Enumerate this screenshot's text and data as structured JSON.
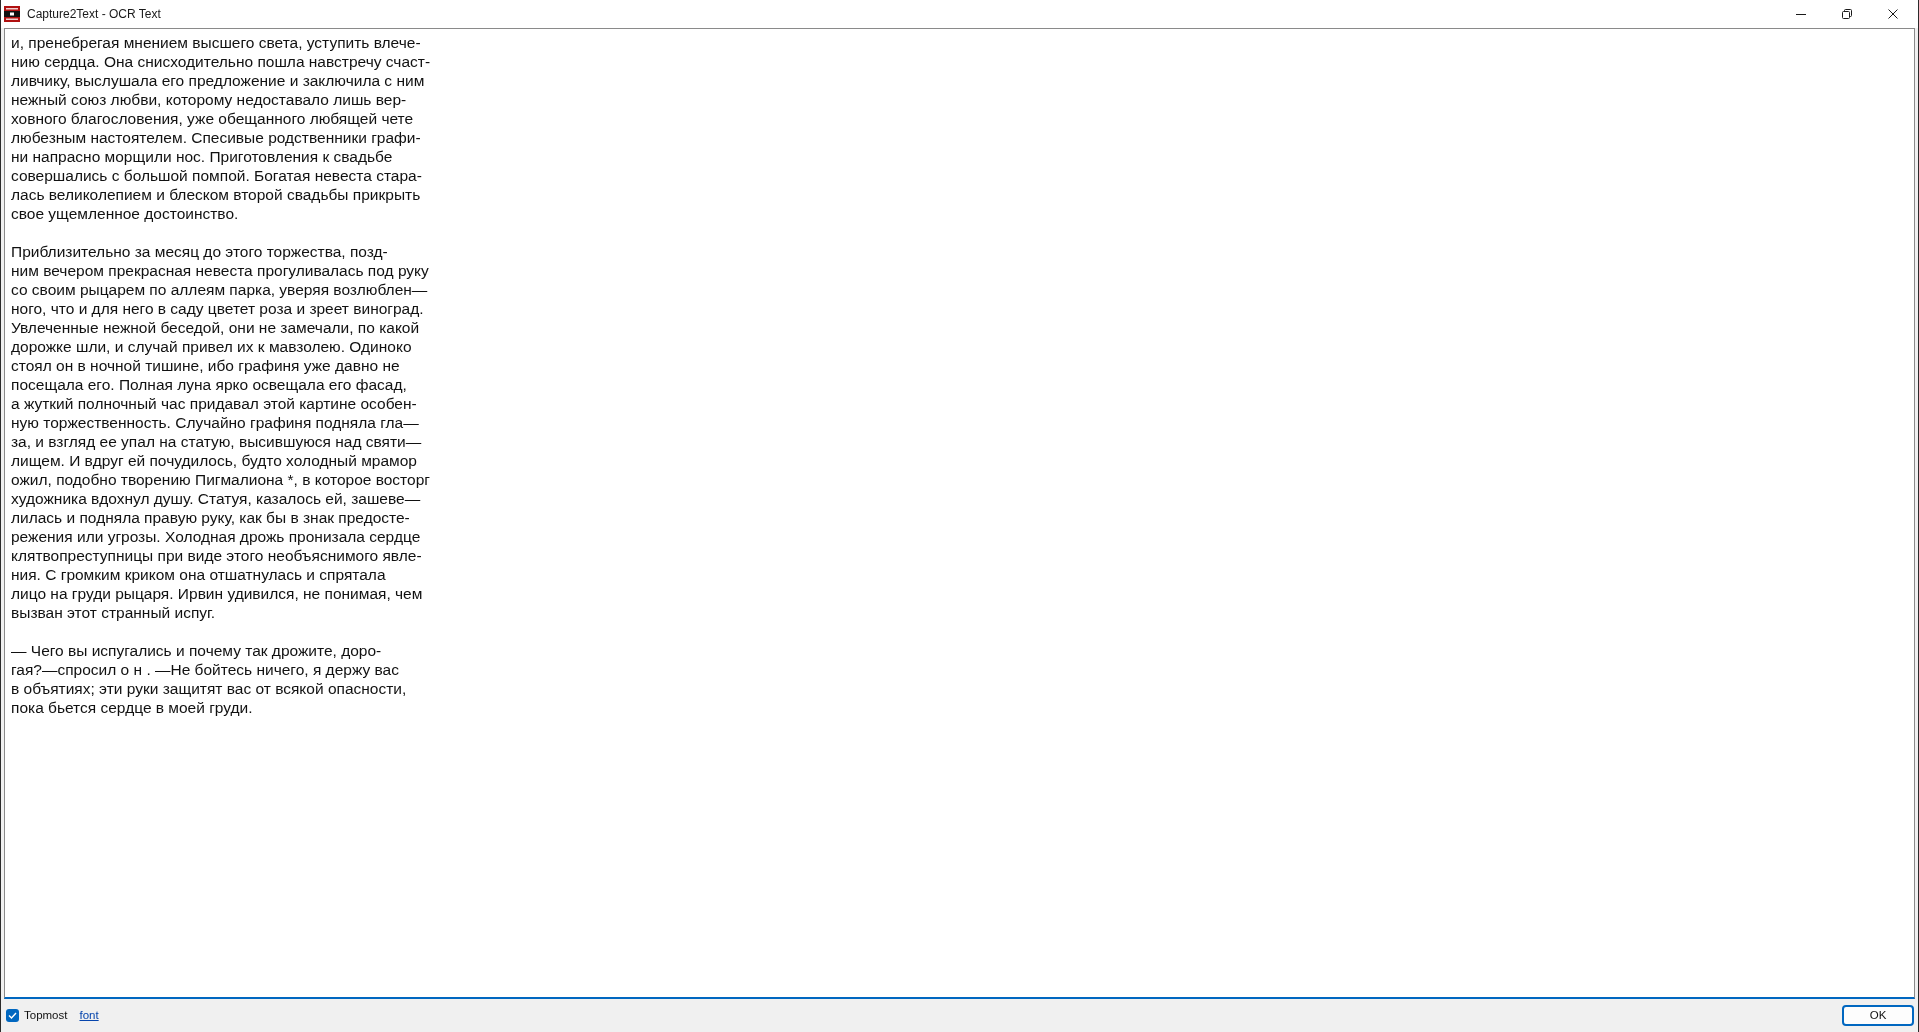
{
  "window": {
    "title": "Capture2Text - OCR Text"
  },
  "ocr_text": {
    "paragraphs": [
      [
        "и, пренебрегая мнением высшего света, уступить влече-",
        "нию сердца. Она снисходительно пошла навстречу счаст-",
        "ливчику, выслушала его предложение и заключила с ним",
        "нежный союз любви, которому недоставало лишь вер-",
        "ховного благословения, уже обещанного любящей чете",
        "любезным настоятелем. Спесивые родственники графи-",
        "ни напрасно морщили нос. Приготовления к свадьбе",
        "совершались с большой помпой. Богатая невеста стара-",
        "лась великолепием и блеском второй свадьбы прикрыть",
        "свое ущемленное достоинство."
      ],
      [
        "Приблизительно за месяц до этого торжества, позд-",
        "ним вечером прекрасная невеста прогуливалась под руку",
        "со своим рыцарем по аллеям парка, уверяя возлюблен—",
        "ного, что и для него в саду цветет роза и зреет виноград.",
        "Увлеченные нежной беседой, они не замечали, по какой",
        "дорожке шли, и случай привел их к мавзолею. Одиноко",
        "стоял он в ночной тишине, ибо графиня уже давно не",
        "посещала его. Полная луна ярко освещала его фасад,",
        "а жуткий полночный час придавал этой картине особен-",
        "ную торжественность. Случайно графиня подняла гла—",
        "за, и взгляд ее упал на статую, высившуюся над святи—",
        "лищем. И вдруг ей почудилось, будто холодный мрамор",
        "ожил, подобно творению Пигмалиона *, в которое восторг",
        "художника вдохнул душу. Статуя, казалось ей, зашеве—",
        "лилась и подняла правую руку, как бы в знак предосте-",
        "режения или угрозы. Холодная дрожь пронизала сердце",
        "клятвопреступницы при виде этого необъяснимого явле-",
        "ния. С громким криком она отшатнулась и спрятала",
        "лицо на груди рыцаря. Ирвин удивился, не понимая, чем",
        "вызван этот странный испуг."
      ],
      [
        "— Чего вы испугались и почему так дрожите, доро-",
        "гая?—спросил о н . —Не бойтесь ничего, я держу вас",
        "в объятиях; эти руки защитят вас от всякой опасности,",
        "пока бьется сердце в моей груди."
      ]
    ]
  },
  "footer": {
    "topmost": {
      "label": "Topmost",
      "checked": true
    },
    "font_link": "font",
    "buttons": [
      "OK"
    ]
  }
}
